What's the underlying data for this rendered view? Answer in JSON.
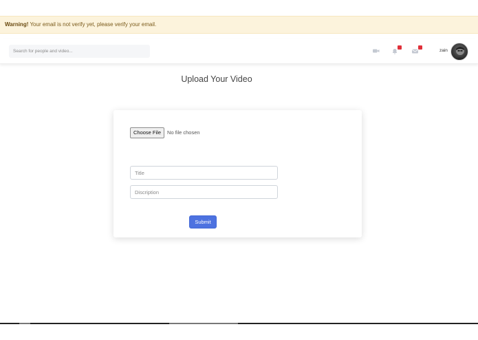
{
  "warning": {
    "strong": "Warning!",
    "message": " Your email is not verify yet, please verify your email."
  },
  "navbar": {
    "search_placeholder": "Search for people and video...",
    "icons": [
      "video-camera-icon",
      "bell-icon",
      "mail-icon"
    ],
    "username": "zain",
    "badge_color": "#e0303a"
  },
  "page": {
    "title": "Upload Your Video"
  },
  "form": {
    "file_button_label": "Choose File",
    "file_status": "No file chosen",
    "title_placeholder": "Title",
    "description_placeholder": "Discription",
    "submit_label": "Submit",
    "submit_color": "#4d72e0"
  }
}
